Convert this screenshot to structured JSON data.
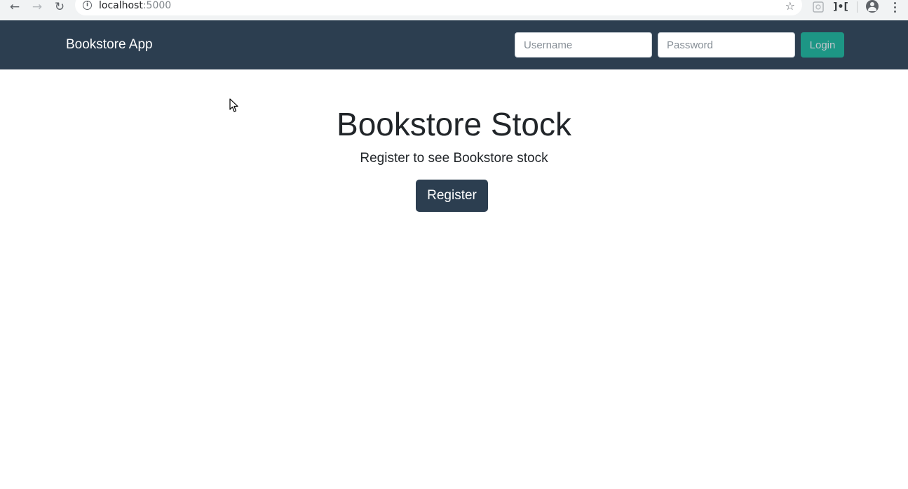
{
  "browser": {
    "url_host": "localhost",
    "url_port": ":5000",
    "icons": [
      "back-arrow-icon",
      "forward-arrow-icon",
      "reload-icon",
      "info-icon",
      "star-icon",
      "extension-icon",
      "extension-icon",
      "profile-icon",
      "more-menu-icon"
    ]
  },
  "navbar": {
    "brand": "Bookstore App",
    "username_placeholder": "Username",
    "password_placeholder": "Password",
    "login_label": "Login",
    "background": "#2c3e50",
    "accent": "#18bc9c"
  },
  "main": {
    "title": "Bookstore Stock",
    "subtitle": "Register to see Bookstore stock",
    "register_label": "Register"
  }
}
